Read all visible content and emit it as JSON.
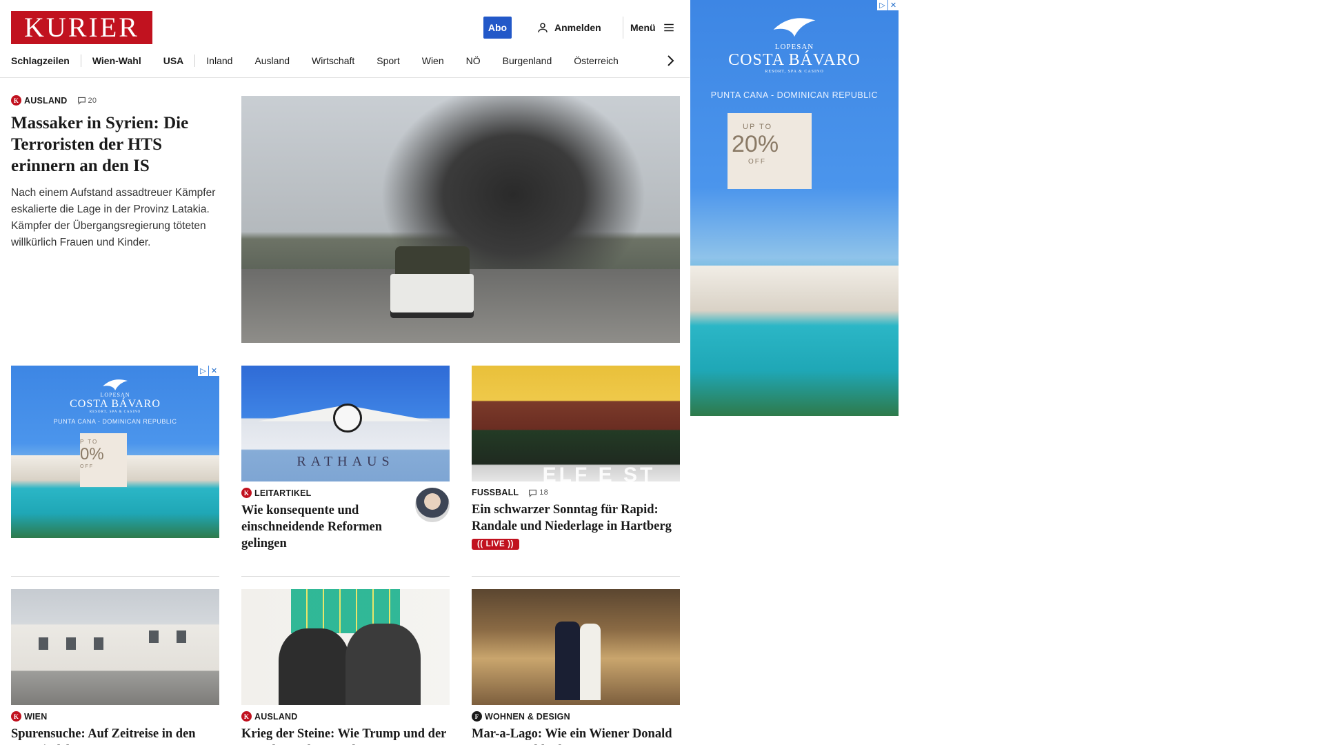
{
  "header": {
    "logo": "KURIER",
    "abo": "Abo",
    "login": "Anmelden",
    "menu": "Menü"
  },
  "nav": {
    "items": [
      "Schlagzeilen",
      "Wien-Wahl",
      "USA",
      "Inland",
      "Ausland",
      "Wirtschaft",
      "Sport",
      "Wien",
      "NÖ",
      "Burgenland",
      "Österreich"
    ]
  },
  "lead": {
    "category": "AUSLAND",
    "comments": "20",
    "headline": "Massaker in Syrien: Die Terroristen der HTS erinnern an den IS",
    "teaser": "Nach einem Aufstand assadtreuer Kämpfer eskalierte die Lage in der Provinz Latakia. Kämpfer der Übergangsregierung töteten willkürlich Frauen und Kinder."
  },
  "cards": [
    {
      "category": "LEITARTIKEL",
      "headline": "Wie konsequente und einschneidende Reformen gelingen",
      "image_text": "RATHAUS"
    },
    {
      "category": "FUSSBALL",
      "comments": "18",
      "headline": "Ein schwarzer Sonntag für Rapid: Randale und Niederlage in Hartberg",
      "live": "LIVE",
      "image_text": "ELF E ST"
    },
    {
      "category": "WIEN",
      "headline": "Spurensuche: Auf Zeitreise in den Gemeindebau"
    },
    {
      "category": "AUSLAND",
      "headline": "Krieg der Steine: Wie Trump und der Rest der Welt um Seltene"
    },
    {
      "category": "WOHNEN & DESIGN",
      "headline": "Mar-a-Lago: Wie ein Wiener Donald Trumps Goldpalast prägte"
    }
  ],
  "ad": {
    "pretitle": "LOPESAN",
    "title": "COSTA BÁVARO",
    "sub": "RESORT, SPA & CASINO",
    "tagline": "PUNTA CANA - DOMINICAN REPUBLIC",
    "upto": "UP TO",
    "pct": "20%",
    "off": "OFF",
    "small_upto": "P TO",
    "small_pct": "0%",
    "small_off": "OFF",
    "badge_info": "▷",
    "badge_close": "✕"
  },
  "colors": {
    "brand_red": "#c1121f",
    "abo_blue": "#2258c8"
  },
  "icons": {
    "user": "user-icon",
    "menu": "hamburger-icon",
    "comment": "comment-icon",
    "nav_next": "chevron-right-icon"
  }
}
